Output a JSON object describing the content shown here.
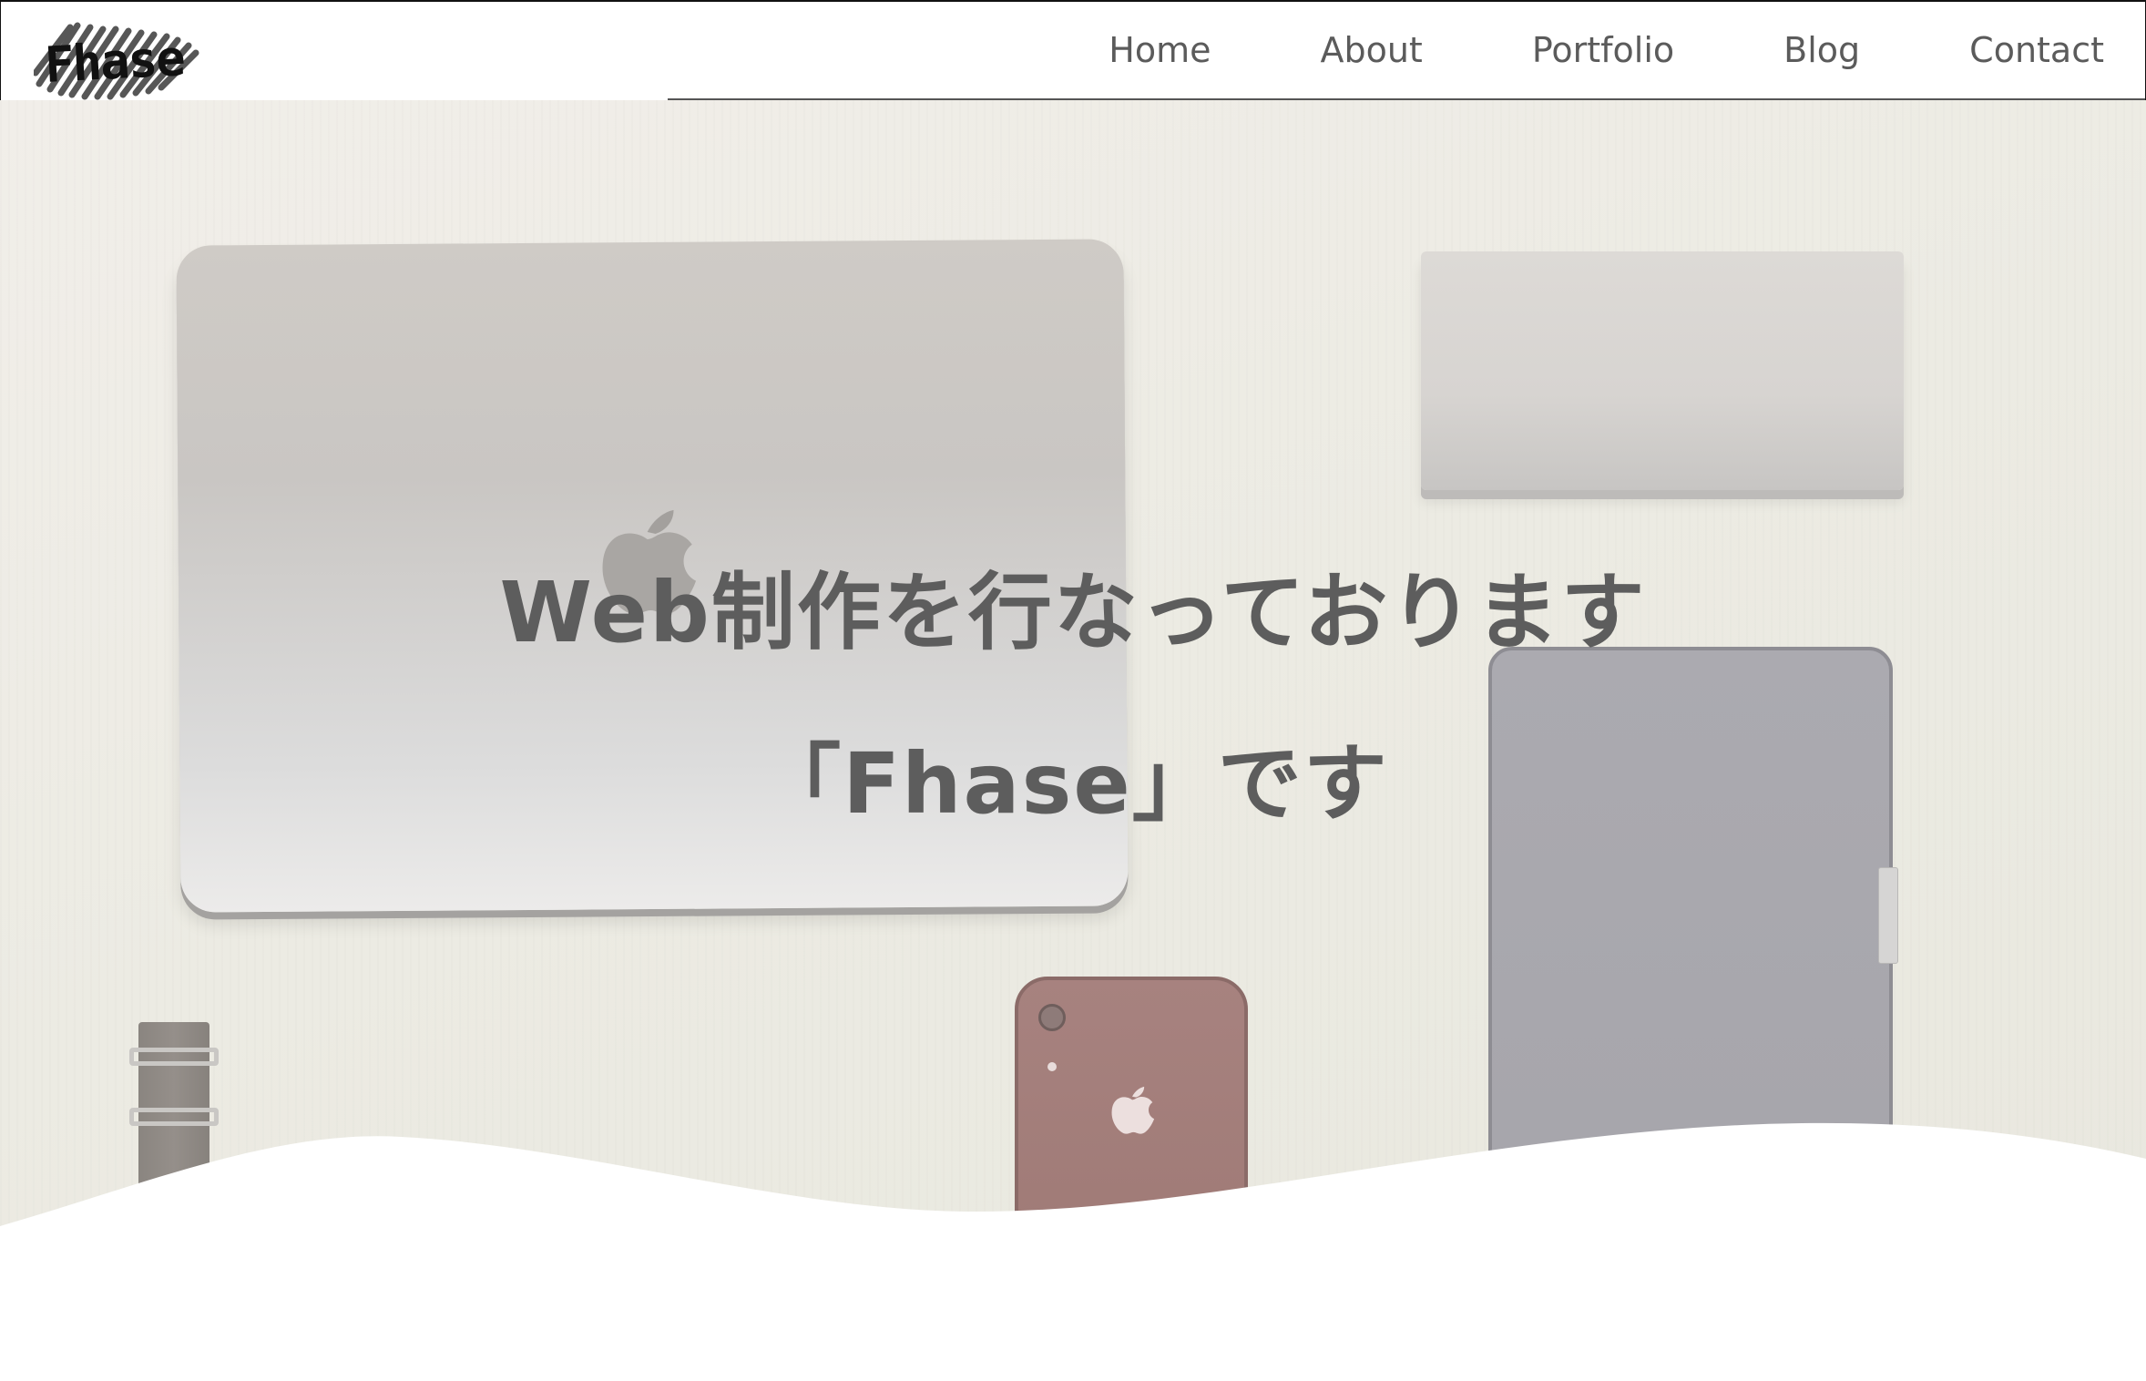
{
  "header": {
    "logo_text": "Fhase",
    "nav": [
      {
        "label": "Home"
      },
      {
        "label": "About"
      },
      {
        "label": "Portfolio"
      },
      {
        "label": "Blog"
      },
      {
        "label": "Contact"
      }
    ]
  },
  "hero": {
    "headline_line1": "Web制作を行なっております",
    "headline_line2": "「Fhase」です"
  },
  "colors": {
    "nav_text": "#5b5b5b",
    "headline_text": "#5d5d5d",
    "logo_text": "#111111",
    "background": "#ffffff"
  }
}
